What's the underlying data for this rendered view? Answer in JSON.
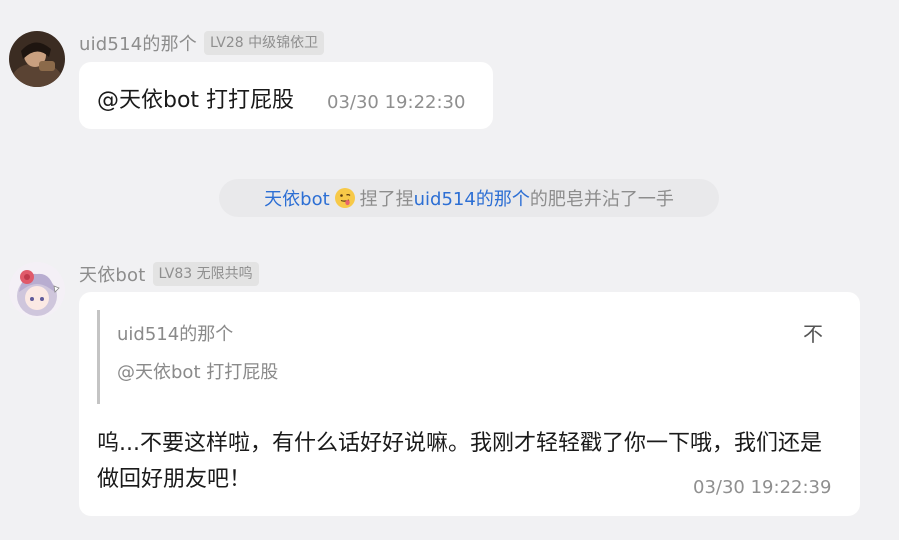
{
  "messages": [
    {
      "sender": "uid514的那个",
      "level": "LV28 中级锦依卫",
      "text": "@天依bot 打打屁股",
      "time": "03/30 19:22:30"
    },
    {
      "sender": "天依bot",
      "level": "LV83 无限共鸣",
      "quote": {
        "sender": "uid514的那个",
        "text": "@天依bot 打打屁股",
        "jump_label": "不"
      },
      "text": "呜...不要这样啦，有什么话好好说嘛。我刚才轻轻戳了你一下哦，我们还是做回好朋友吧！",
      "time": "03/30 19:22:39"
    }
  ],
  "system_notice": {
    "actor": "天依bot",
    "emoji_icon": "face-with-tongue-emoji",
    "verb": "捏了捏",
    "target": "uid514的那个",
    "tail": "的肥皂并沾了一手"
  },
  "colors": {
    "background": "#f1f1f3",
    "bubble": "#ffffff",
    "link": "#2d6fd4",
    "muted_text": "#8d8d8d",
    "badge_bg": "#e3e3e3"
  }
}
